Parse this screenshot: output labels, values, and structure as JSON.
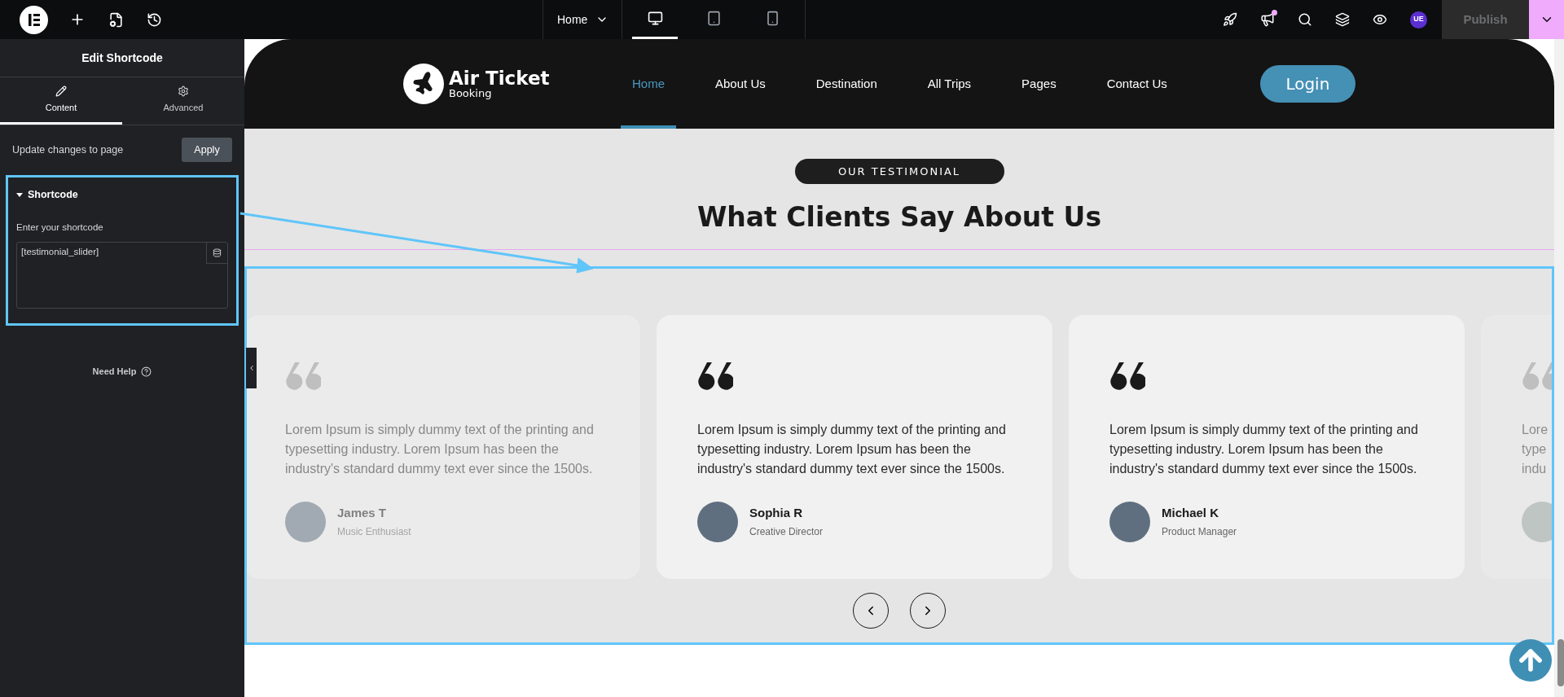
{
  "topbar": {
    "page": "Home",
    "devices": [
      {
        "kind": "desktop",
        "selected": true
      },
      {
        "kind": "tablet",
        "selected": false
      },
      {
        "kind": "mobile",
        "selected": false
      }
    ],
    "notification": true,
    "user_initials": "UE",
    "publish": "Publish"
  },
  "panel": {
    "title": "Edit Shortcode",
    "tabs": [
      {
        "kind": "content",
        "label": "Content",
        "selected": true
      },
      {
        "kind": "advanced",
        "label": "Advanced",
        "selected": false
      }
    ],
    "update_label": "Update changes to page",
    "apply": "Apply",
    "section": {
      "title": "Shortcode",
      "expanded": true,
      "field_label": "Enter your shortcode",
      "value": "[testimonial_slider]"
    },
    "help": "Need Help"
  },
  "site": {
    "logo": {
      "name": "Air Ticket",
      "tagline": "Booking"
    },
    "nav": [
      {
        "label": "Home",
        "selected": true
      },
      {
        "label": "About Us",
        "selected": false
      },
      {
        "label": "Destination",
        "selected": false
      },
      {
        "label": "All Trips",
        "selected": false
      },
      {
        "label": "Pages",
        "selected": false
      },
      {
        "label": "Contact Us",
        "selected": false
      }
    ],
    "login": "Login",
    "testimonials": {
      "badge": "OUR TESTIMONIAL",
      "heading": "What Clients Say About Us",
      "cards": [
        {
          "kind": "full",
          "dimmed": true,
          "quote": "Lorem Ipsum is simply dummy text of the printing and typesetting industry. Lorem Ipsum has been the industry's standard dummy text ever since the 1500s.",
          "name": "James T",
          "role": "Music Enthusiast"
        },
        {
          "kind": "full",
          "dimmed": false,
          "quote": "Lorem Ipsum is simply dummy text of the printing and typesetting industry. Lorem Ipsum has been the industry's standard dummy text ever since the 1500s.",
          "name": "Sophia R",
          "role": "Creative Director"
        },
        {
          "kind": "full",
          "dimmed": false,
          "quote": "Lorem Ipsum is simply dummy text of the printing and typesetting industry. Lorem Ipsum has been the industry's standard dummy text ever since the 1500s.",
          "name": "Michael K",
          "role": "Product Manager"
        },
        {
          "kind": "partial",
          "dimmed": true,
          "lines": [
            "Lore",
            "type",
            "indu"
          ]
        }
      ]
    }
  }
}
